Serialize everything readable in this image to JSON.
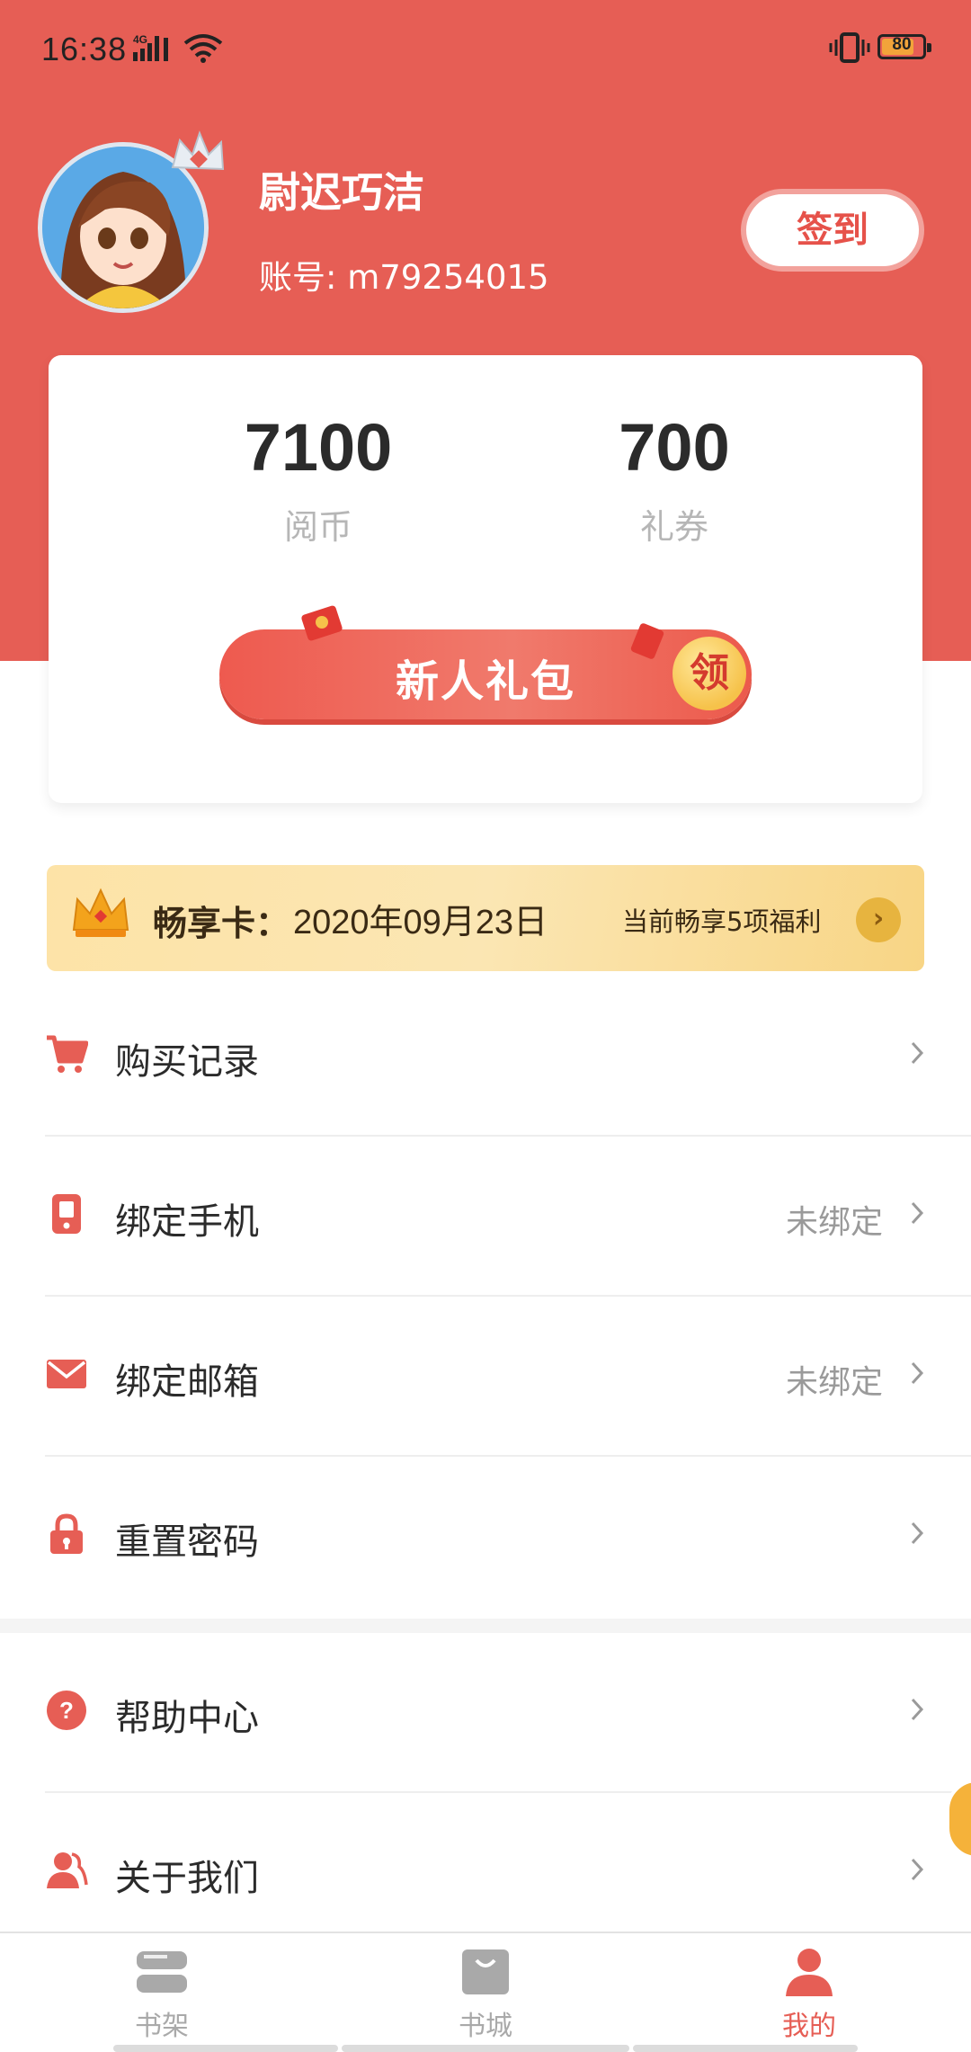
{
  "status_bar": {
    "time": "16:38",
    "network": "4G",
    "battery": "80",
    "battery_level": 0.8,
    "icons": [
      "signal-icon",
      "wifi-icon",
      "vibrate-icon",
      "battery-icon"
    ]
  },
  "profile": {
    "name": "尉迟巧洁",
    "account": "账号: m79254015",
    "checkin_label": "签到"
  },
  "wallet": {
    "coins_value": "7100",
    "coins_label": "阅币",
    "coupons_value": "700",
    "coupons_label": "礼券",
    "gift_label": "新人礼包",
    "claim_label": "领"
  },
  "vip": {
    "title": "畅享卡：",
    "date": "2020年09月23日",
    "benefit": "当前畅享5项福利"
  },
  "menu": [
    {
      "label": "购买记录",
      "status": "",
      "icon": "cart-icon"
    },
    {
      "label": "绑定手机",
      "status": "未绑定",
      "icon": "phone-icon"
    },
    {
      "label": "绑定邮箱",
      "status": "未绑定",
      "icon": "mail-icon"
    },
    {
      "label": "重置密码",
      "status": "",
      "icon": "lock-icon"
    },
    {
      "label": "帮助中心",
      "status": "",
      "icon": "help-icon"
    },
    {
      "label": "关于我们",
      "status": "",
      "icon": "people-icon"
    }
  ],
  "bottom_nav": [
    {
      "label": "书架",
      "icon": "bookshelf-icon",
      "active": false
    },
    {
      "label": "书城",
      "icon": "bookstore-icon",
      "active": false
    },
    {
      "label": "我的",
      "icon": "profile-icon",
      "active": true
    }
  ],
  "colors": {
    "brand": "#e65e55",
    "accent_text": "#e6524a",
    "gold": "#f8d585",
    "inactive_nav": "#a9a9a9"
  }
}
